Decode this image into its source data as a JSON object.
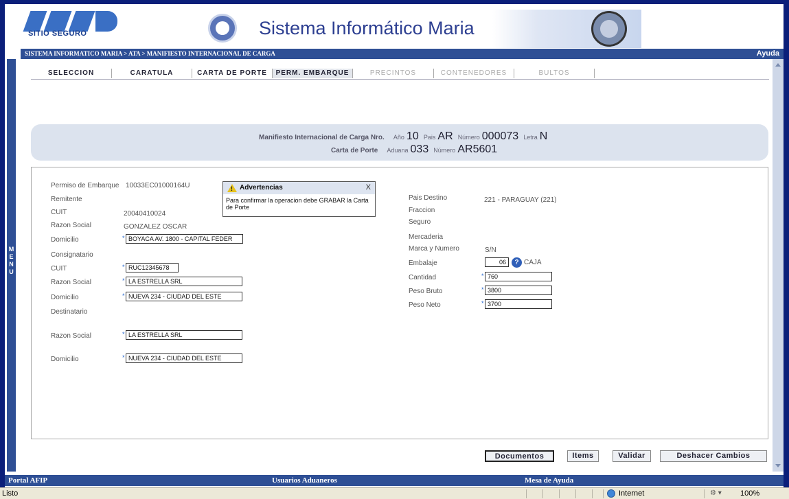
{
  "header": {
    "title": "Sistema Informático Maria",
    "logo_caption": "SITIO SEGURO"
  },
  "breadcrumb": "SISTEMA INFORMATICO MARIA > ATA > MANIFIESTO INTERNACIONAL DE CARGA",
  "help": "Ayuda",
  "menu_letters": [
    "M",
    "E",
    "N",
    "U"
  ],
  "tabs": [
    {
      "label": "SELECCION",
      "state": "normal"
    },
    {
      "label": "CARATULA",
      "state": "normal"
    },
    {
      "label": "CARTA DE PORTE",
      "state": "normal"
    },
    {
      "label": "PERM. EMBARQUE",
      "state": "active"
    },
    {
      "label": "PRECINTOS",
      "state": "disabled"
    },
    {
      "label": "CONTENEDORES",
      "state": "disabled"
    },
    {
      "label": "BULTOS",
      "state": "disabled"
    }
  ],
  "manifest": {
    "label": "Manifiesto Internacional de Carga Nro.",
    "anio_label": "Año",
    "anio": "10",
    "pais_label": "Pais",
    "pais": "AR",
    "numero_label": "Número",
    "numero": "000073",
    "letra_label": "Letra",
    "letra": "N",
    "carta_label": "Carta de Porte",
    "aduana_label": "Aduana",
    "aduana": "033",
    "numero2_label": "Número",
    "numero2": "AR5601"
  },
  "form": {
    "permiso_label": "Permiso de Embarque",
    "permiso": "10033EC01000164U",
    "remitente_label": "Remitente",
    "rem_cuit_label": "CUIT",
    "rem_cuit": "20040410024",
    "rem_razon_label": "Razon Social",
    "rem_razon": "GONZALEZ OSCAR",
    "rem_domicilio_label": "Domicilio",
    "rem_domicilio": "BOYACA AV. 1800   - CAPITAL FEDER",
    "consignatario_label": "Consignatario",
    "con_cuit_label": "CUIT",
    "con_cuit": "RUC12345678",
    "con_razon_label": "Razon Social",
    "con_razon": "LA ESTRELLA SRL",
    "con_domicilio_label": "Domicilio",
    "con_domicilio": "NUEVA 234 - CIUDAD DEL ESTE",
    "destinatario_label": "Destinatario",
    "des_razon_label": "Razon Social",
    "des_razon": "LA ESTRELLA SRL",
    "des_domicilio_label": "Domicilio",
    "des_domicilio": "NUEVA 234 - CIUDAD DEL ESTE",
    "pais_destino_label": "Pais Destino",
    "pais_destino": "221 - PARAGUAY (221)",
    "fraccion_label": "Fraccion",
    "seguro_label": "Seguro",
    "mercaderia_label": "Mercaderia",
    "marca_label": "Marca y Numero",
    "marca": "S/N",
    "embalaje_label": "Embalaje",
    "embalaje": "06",
    "embalaje_desc": "CAJA",
    "cantidad_label": "Cantidad",
    "cantidad": "760",
    "peso_bruto_label": "Peso Bruto",
    "peso_bruto": "3800",
    "peso_neto_label": "Peso Neto",
    "peso_neto": "3700",
    "required_mark": "*"
  },
  "popup": {
    "title": "Advertencias",
    "close": "X",
    "message": "Para confirmar la operacion debe GRABAR la Carta de Porte"
  },
  "buttons": {
    "documentos": "Documentos",
    "items": "Items",
    "validar": "Validar",
    "deshacer": "Deshacer Cambios"
  },
  "bottom_nav": {
    "portal": "Portal AFIP",
    "usuarios": "Usuarios Aduaneros",
    "mesa": "Mesa de Ayuda"
  },
  "status": {
    "text": "Listo",
    "zone": "Internet",
    "zoom": "100%"
  }
}
